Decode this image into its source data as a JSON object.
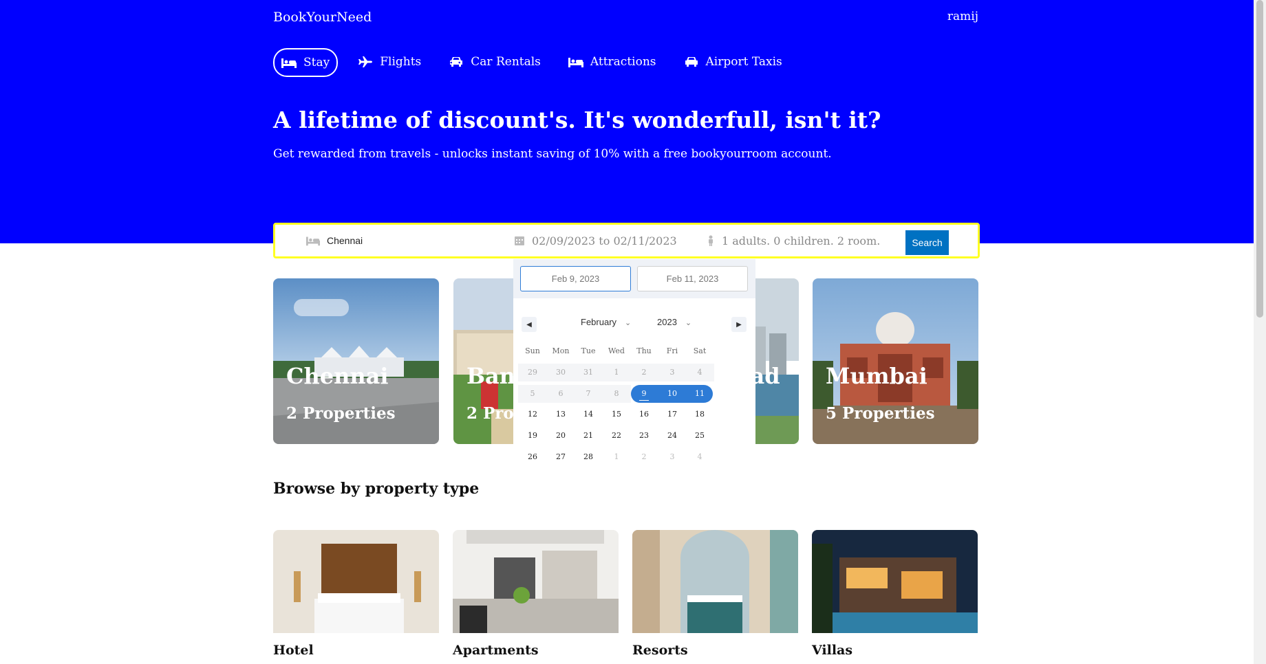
{
  "brand": "BookYourNeed",
  "user": "ramij",
  "nav_tabs": [
    {
      "label": "Stay",
      "icon": "bed-icon",
      "active": true
    },
    {
      "label": "Flights",
      "icon": "plane-icon",
      "active": false
    },
    {
      "label": "Car Rentals",
      "icon": "car-icon",
      "active": false
    },
    {
      "label": "Attractions",
      "icon": "bed-icon",
      "active": false
    },
    {
      "label": "Airport Taxis",
      "icon": "taxi-icon",
      "active": false
    }
  ],
  "hero": {
    "title": "A lifetime of discount's. It's wonderfull, isn't it?",
    "description": "Get rewarded from travels - unlocks instant saving of 10% with a free bookyourroom account."
  },
  "search": {
    "destination": "Chennai",
    "dates": "02/09/2023 to 02/11/2023",
    "guests": "1 adults. 0 children. 2 room.",
    "button": "Search"
  },
  "calendar": {
    "start_input": "Feb 9, 2023",
    "end_input": "Feb 11, 2023",
    "month": "February",
    "year": "2023",
    "weekdays": [
      "Sun",
      "Mon",
      "Tue",
      "Wed",
      "Thu",
      "Fri",
      "Sat"
    ],
    "weeks": [
      [
        "29",
        "30",
        "31",
        "1",
        "2",
        "3",
        "4"
      ],
      [
        "5",
        "6",
        "7",
        "8",
        "9",
        "10",
        "11"
      ],
      [
        "12",
        "13",
        "14",
        "15",
        "16",
        "17",
        "18"
      ],
      [
        "19",
        "20",
        "21",
        "22",
        "23",
        "24",
        "25"
      ],
      [
        "26",
        "27",
        "28",
        "1",
        "2",
        "3",
        "4"
      ]
    ],
    "selected_range": [
      "9",
      "11"
    ]
  },
  "city_cards": [
    {
      "name": "Chennai",
      "properties": "2 Properties"
    },
    {
      "name": "Bangalore",
      "properties": "2 Properties"
    },
    {
      "name": "Hyderabad",
      "properties": ""
    },
    {
      "name": "Mumbai",
      "properties": "5 Properties"
    }
  ],
  "browse_title": "Browse by property type",
  "property_types": [
    "Hotel",
    "Apartments",
    "Resorts",
    "Villas"
  ]
}
